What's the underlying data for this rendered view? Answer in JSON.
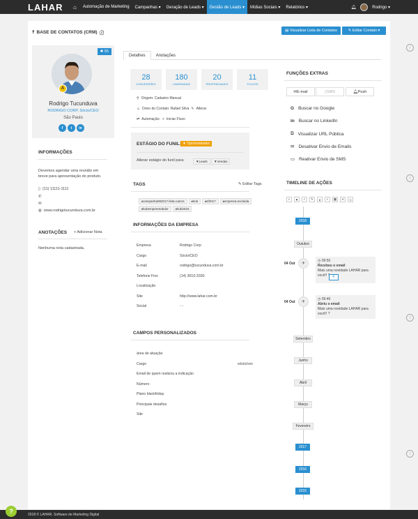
{
  "topbar": {
    "logo": "LAHAR",
    "home_icon": "⌂",
    "nav": [
      "Automação de Marketing",
      "Campanhas ▾",
      "Geração de Leads ▾",
      "Gestão de Leads ▾",
      "Mídias Sociais ▾",
      "Relatórios ▾"
    ],
    "user": "Rodrigo ▾"
  },
  "page": {
    "title": "BASE DE CONTATOS (CRM)",
    "btn_view_list": "Visualizar Lista de Contatos",
    "btn_edit": "Editar Contato ▾"
  },
  "profile": {
    "score": "55",
    "badge": "A",
    "name": "Rodrigo Tucunduva",
    "company_role": "RODRIGO CORP, Sócio/CEO",
    "city": "São Paulo",
    "socials": [
      "f",
      "t",
      "in"
    ]
  },
  "info": {
    "title": "INFORMAÇÕES",
    "note": "Devemos agendar uma reunião em breve para apresentação do produto.",
    "phone": "(11) 11111-1111",
    "website": "www.rodrigotucunduva.com.br"
  },
  "notes": {
    "title": "ANOTAÇÕES",
    "add": "Adicionar Nota",
    "empty": "Nenhuma nota cadastrada."
  },
  "tabs": [
    "Detalhes",
    "Anotações"
  ],
  "stats": [
    {
      "n": "28",
      "l": "CONVERSÕES"
    },
    {
      "n": "180",
      "l": "CAMPANHAS"
    },
    {
      "n": "20",
      "l": "PROPRIEDADES"
    },
    {
      "n": "11",
      "l": "FLUXOS"
    }
  ],
  "details": {
    "origin": "Origem: Cadastro Manual",
    "owner": "Dono do Contato: Rafael Silva",
    "owner_action": "Alterar",
    "automation": "Automação:",
    "automation_action": "Iniciar Fluxo"
  },
  "funnel": {
    "title": "ESTÁGIO DO FUNIL:",
    "stage": "Oportunidades",
    "change_label": "Alterar estágio do funil para:",
    "opt1": "Leads",
    "opt2": "Vendas"
  },
  "tags": {
    "title": "TAGS",
    "edit": "Editar Tags",
    "items": [
      "campanha082017-lista-outros",
      "hub",
      "sf2017",
      "empresa-excluida",
      "hubempreendedor",
      "hub2016"
    ]
  },
  "company": {
    "title": "INFORMAÇÕES DA EMPRESA",
    "rows": [
      [
        "Empresa",
        "Rodrigo Corp"
      ],
      [
        "Cargo",
        "Sócio/CEO"
      ],
      [
        "E-mail",
        "rodrigo@tucunduva.com.br"
      ],
      [
        "Telefone Fixo",
        "(14) 3010-3330"
      ],
      [
        "Localização",
        ""
      ],
      [
        "Site",
        "http://www.lahar.com.br"
      ],
      [
        "Social",
        ""
      ]
    ]
  },
  "custom": {
    "title": "CAMPOS PERSONALIZADOS",
    "rows": [
      [
        "área de atuação",
        ""
      ],
      [
        "Cargo",
        "sócio/ceo"
      ],
      [
        "Email de quem realizou a indicação",
        ""
      ],
      [
        "Número",
        ""
      ],
      [
        "Plano blackfriday",
        ""
      ],
      [
        "Principais desafios",
        ""
      ],
      [
        "Site",
        ""
      ]
    ]
  },
  "extras": {
    "title": "FUNÇÕES EXTRAS",
    "channels": [
      "E-mail",
      "SMS",
      "Push"
    ],
    "items": [
      "Buscar no Google",
      "Buscar no LinkedIn",
      "Visualizar URL Pública",
      "Desativar Envio de Emails",
      "Reativar Envio de SMS"
    ]
  },
  "timeline": {
    "title": "TIMELINE DE AÇÕES",
    "y2018": "2018",
    "outubro": "Outubro",
    "date1": "04 Out",
    "time1": "09:50",
    "ev1_title": "Recebeu o email",
    "ev1_text": "Mais uma novidade LAHAR para você!! ?",
    "date2": "04 Out",
    "time2": "09:46",
    "ev2_title": "Abriu o email",
    "ev2_text": "Mais uma novidade LAHAR para você!! ?",
    "setembro": "Setembro",
    "junho": "Junho",
    "abril": "Abril",
    "marco": "Março",
    "fevereiro": "Fevereiro",
    "y2017": "2017",
    "y2016": "2016",
    "y2015": "2015"
  },
  "footer": "2018 © LAHAR. Software de Marketing Digital"
}
